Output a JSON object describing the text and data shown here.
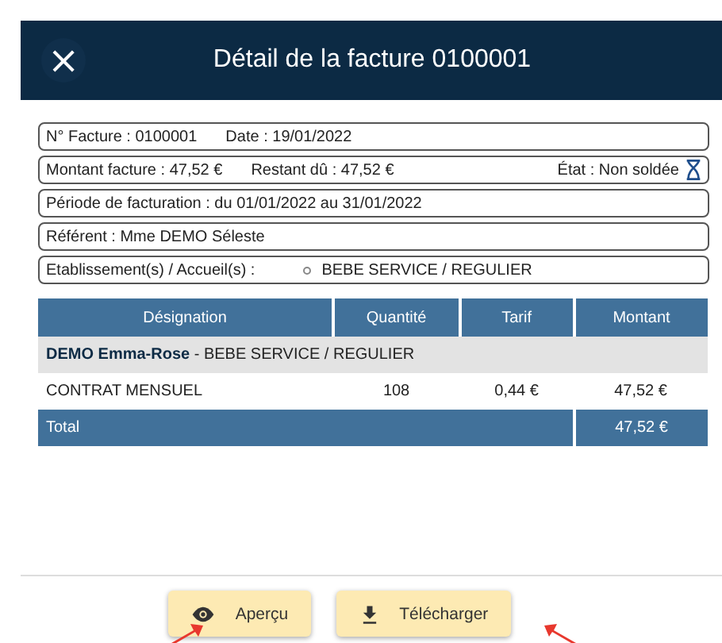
{
  "dialog": {
    "title": "Détail de la facture 0100001",
    "close": "×"
  },
  "info_rows": [
    {
      "items": [
        {
          "kind": "plain",
          "text": "N° Facture : 0100001"
        },
        {
          "kind": "plain",
          "text": "Date : 19/01/2022"
        }
      ]
    },
    {
      "items": [
        {
          "kind": "plain",
          "text": "Montant facture : 47,52 €"
        },
        {
          "kind": "plain",
          "text": "Restant dû : 47,52 €"
        },
        {
          "kind": "status",
          "text": "État : Non soldée"
        }
      ]
    },
    {
      "items": [
        {
          "kind": "plain",
          "text": "Période de facturation : du 01/01/2022 au 31/01/2022"
        }
      ]
    },
    {
      "items": [
        {
          "kind": "plain",
          "text": "Référent : Mme DEMO Séleste"
        }
      ]
    },
    {
      "items": [
        {
          "kind": "plain",
          "text": "Etablissement(s) / Accueil(s) :"
        },
        {
          "kind": "bulleted",
          "text": "BEBE SERVICE / REGULIER"
        }
      ]
    }
  ],
  "table": {
    "columns": [
      "Désignation",
      "Quantité",
      "Tarif",
      "Montant"
    ],
    "rows": [
      {
        "kind": "group",
        "text": "**DEMO Emma-Rose** - BEBE SERVICE / REGULIER"
      },
      {
        "kind": "line",
        "cells": [
          "CONTRAT MENSUEL",
          "108",
          "0,44 €",
          "47,52 €"
        ]
      },
      {
        "kind": "total",
        "label": "Total",
        "amount": "47,52 €"
      }
    ]
  },
  "buttons": [
    {
      "label": "Aperçu"
    },
    {
      "label": "Télécharger"
    }
  ]
}
